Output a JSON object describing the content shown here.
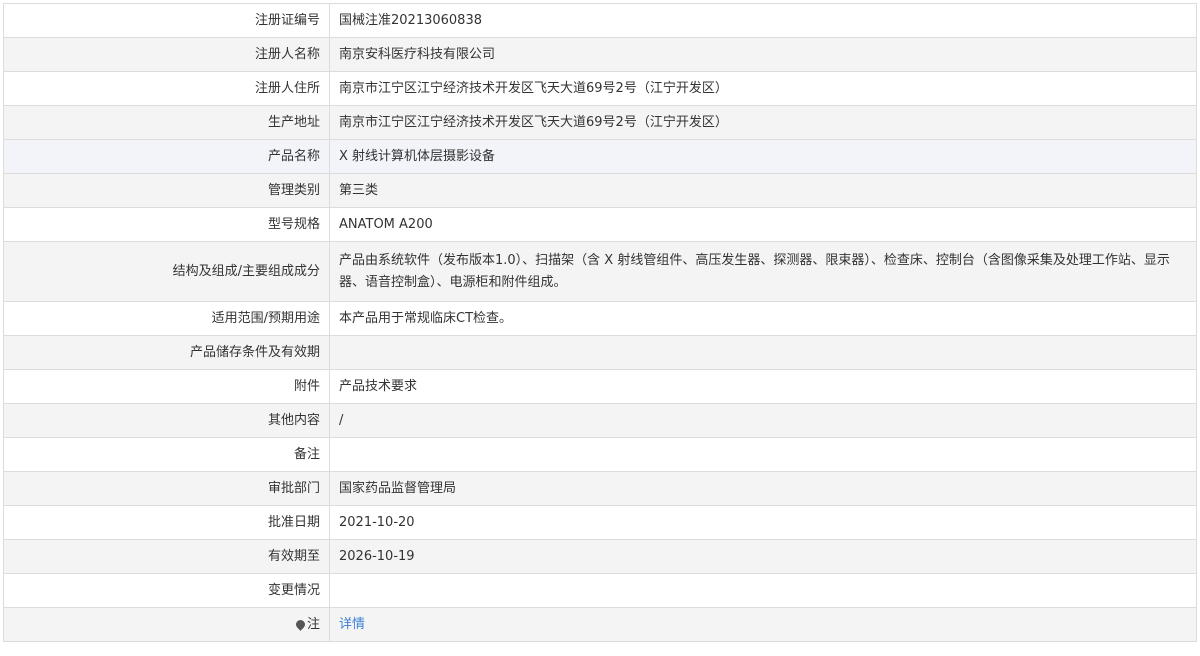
{
  "rows": [
    {
      "label": "注册证编号",
      "value": "国械注准20213060838"
    },
    {
      "label": "注册人名称",
      "value": "南京安科医疗科技有限公司"
    },
    {
      "label": "注册人住所",
      "value": "南京市江宁区江宁经济技术开发区飞天大道69号2号（江宁开发区）"
    },
    {
      "label": "生产地址",
      "value": "南京市江宁区江宁经济技术开发区飞天大道69号2号（江宁开发区）"
    },
    {
      "label": "产品名称",
      "value": "X 射线计算机体层摄影设备"
    },
    {
      "label": "管理类别",
      "value": "第三类"
    },
    {
      "label": "型号规格",
      "value": "ANATOM A200"
    },
    {
      "label": "结构及组成/主要组成成分",
      "value": "产品由系统软件（发布版本1.0）、扫描架（含 X 射线管组件、高压发生器、探测器、限束器）、检查床、控制台（含图像采集及处理工作站、显示器、语音控制盒）、电源柜和附件组成。"
    },
    {
      "label": "适用范围/预期用途",
      "value": "本产品用于常规临床CT检查。"
    },
    {
      "label": "产品储存条件及有效期",
      "value": ""
    },
    {
      "label": "附件",
      "value": "产品技术要求"
    },
    {
      "label": "其他内容",
      "value": "/"
    },
    {
      "label": "备注",
      "value": ""
    },
    {
      "label": "审批部门",
      "value": "国家药品监督管理局"
    },
    {
      "label": "批准日期",
      "value": "2021-10-20"
    },
    {
      "label": "有效期至",
      "value": "2026-10-19"
    },
    {
      "label": "变更情况",
      "value": ""
    }
  ],
  "note": {
    "label": "注",
    "icon": "pin-icon",
    "link_text": "详情"
  },
  "colors": {
    "border": "#dcdcdc",
    "shaded_row": "#f4f4f4",
    "highlight_row": "#f2f4f9",
    "link": "#3d7fd6",
    "text": "#333333"
  }
}
